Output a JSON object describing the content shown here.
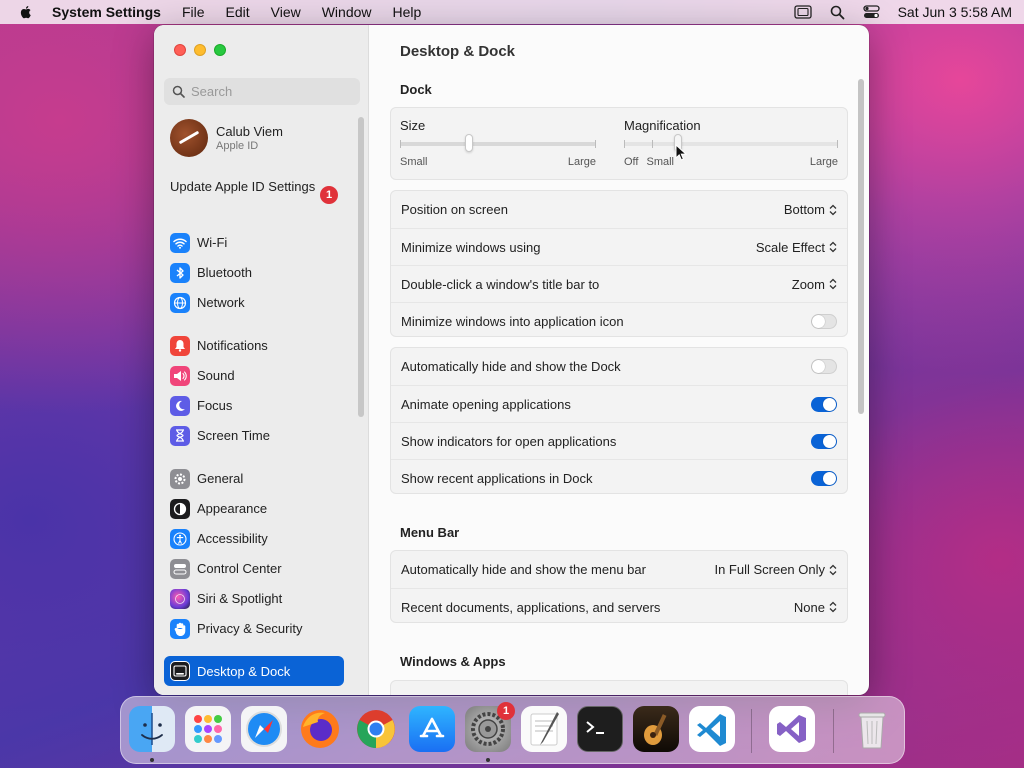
{
  "menubar": {
    "app_name": "System Settings",
    "items": [
      "File",
      "Edit",
      "View",
      "Window",
      "Help"
    ],
    "clock": "Sat Jun 3  5:58 AM"
  },
  "sidebar": {
    "search_placeholder": "Search",
    "profile": {
      "name": "Calub Viem",
      "subtitle": "Apple ID"
    },
    "update": {
      "label": "Update Apple ID Settings",
      "badge": "1"
    },
    "items": [
      {
        "label": "Wi-Fi",
        "icon": "wifi-icon",
        "color": "#1a82fb"
      },
      {
        "label": "Bluetooth",
        "icon": "bluetooth-icon",
        "color": "#1a82fb"
      },
      {
        "label": "Network",
        "icon": "globe-icon",
        "color": "#1a82fb"
      },
      {
        "label": "Notifications",
        "icon": "bell-icon",
        "color": "#f0453a"
      },
      {
        "label": "Sound",
        "icon": "speaker-icon",
        "color": "#f0457a"
      },
      {
        "label": "Focus",
        "icon": "moon-icon",
        "color": "#5e5ce6"
      },
      {
        "label": "Screen Time",
        "icon": "hourglass-icon",
        "color": "#5e5ce6"
      },
      {
        "label": "General",
        "icon": "gear-icon",
        "color": "#8e8e93"
      },
      {
        "label": "Appearance",
        "icon": "appearance-icon",
        "color": "#1c1c1e"
      },
      {
        "label": "Accessibility",
        "icon": "accessibility-icon",
        "color": "#1a82fb"
      },
      {
        "label": "Control Center",
        "icon": "switches-icon",
        "color": "#8e8e93"
      },
      {
        "label": "Siri & Spotlight",
        "icon": "siri-icon",
        "color": "#9b59b6"
      },
      {
        "label": "Privacy & Security",
        "icon": "hand-icon",
        "color": "#1a82fb"
      },
      {
        "label": "Desktop & Dock",
        "icon": "dock-icon",
        "color": "#1c1c1e"
      }
    ]
  },
  "content": {
    "title": "Desktop & Dock",
    "dock_section": {
      "heading": "Dock",
      "size": {
        "label": "Size",
        "min_label": "Small",
        "max_label": "Large",
        "value": 0.35
      },
      "magnification": {
        "label": "Magnification",
        "off_label": "Off",
        "min_label": "Small",
        "max_label": "Large",
        "value": 0.25
      },
      "rows": [
        {
          "label": "Position on screen",
          "value": "Bottom"
        },
        {
          "label": "Minimize windows using",
          "value": "Scale Effect"
        },
        {
          "label": "Double-click a window's title bar to",
          "value": "Zoom"
        },
        {
          "label": "Minimize windows into application icon",
          "toggle": false
        }
      ],
      "toggles": [
        {
          "label": "Automatically hide and show the Dock",
          "on": false
        },
        {
          "label": "Animate opening applications",
          "on": true
        },
        {
          "label": "Show indicators for open applications",
          "on": true
        },
        {
          "label": "Show recent applications in Dock",
          "on": true
        }
      ]
    },
    "menubar_section": {
      "heading": "Menu Bar",
      "rows": [
        {
          "label": "Automatically hide and show the menu bar",
          "value": "In Full Screen Only"
        },
        {
          "label": "Recent documents, applications, and servers",
          "value": "None"
        }
      ]
    },
    "windows_section": {
      "heading": "Windows & Apps"
    }
  },
  "dock": {
    "apps": [
      {
        "name": "finder-icon",
        "running": true
      },
      {
        "name": "launchpad-icon",
        "running": false
      },
      {
        "name": "safari-icon",
        "running": false
      },
      {
        "name": "firefox-icon",
        "running": false
      },
      {
        "name": "chrome-icon",
        "running": false
      },
      {
        "name": "app-store-icon",
        "running": false
      },
      {
        "name": "system-settings-icon",
        "running": true,
        "badge": "1"
      },
      {
        "name": "textedit-icon",
        "running": false
      },
      {
        "name": "terminal-icon",
        "running": false
      },
      {
        "name": "garageband-icon",
        "running": false
      },
      {
        "name": "vscode-icon",
        "running": false
      },
      {
        "name": "visual-studio-icon",
        "running": false
      },
      {
        "name": "trash-icon",
        "running": false
      }
    ]
  }
}
